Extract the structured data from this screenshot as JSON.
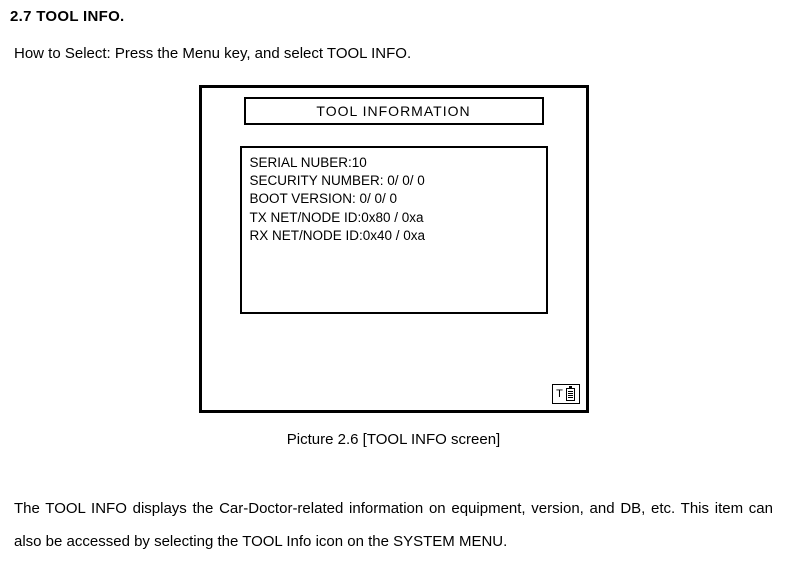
{
  "section": {
    "heading": "2.7 TOOL INFO.",
    "how_to": "How to Select: Press the Menu key, and select TOOL INFO."
  },
  "device": {
    "title": "TOOL INFORMATION",
    "lines": {
      "l1": "SERIAL NUBER:10",
      "l2": "SECURITY NUMBER: 0/ 0/ 0",
      "l3": "BOOT VERSION: 0/ 0/ 0",
      "l4": "TX NET/NODE ID:0x80 / 0xa",
      "l5": "RX NET/NODE ID:0x40 / 0xa"
    }
  },
  "caption": "Picture 2.6 [TOOL INFO screen]",
  "paragraph": "The TOOL INFO displays the Car-Doctor-related information on equipment, version, and DB, etc. This item can also be accessed by selecting the TOOL Info icon on the SYSTEM MENU."
}
